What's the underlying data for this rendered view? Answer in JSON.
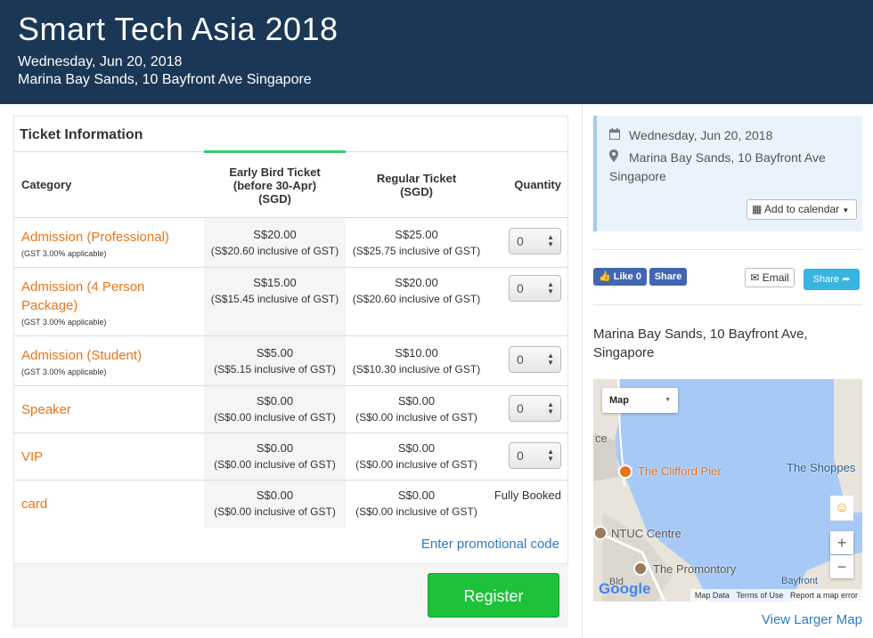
{
  "header": {
    "title": "Smart Tech Asia 2018",
    "date": "Wednesday, Jun 20, 2018",
    "venue": "Marina Bay Sands, 10 Bayfront Ave Singapore"
  },
  "tickets": {
    "section_title": "Ticket Information",
    "columns": {
      "category": "Category",
      "early_line1": "Early Bird Ticket",
      "early_line2": "(before 30-Apr)",
      "early_line3": "(SGD)",
      "regular_line1": "Regular Ticket",
      "regular_line2": "(SGD)",
      "quantity": "Quantity"
    },
    "rows": [
      {
        "name_line1": "Admission (Professional)",
        "name_line2": "",
        "gst": "(GST 3.00% applicable)",
        "early_price": "S$20.00",
        "early_incl": "(S$20.60 inclusive of GST)",
        "regular_price": "S$25.00",
        "regular_incl": "(S$25.75 inclusive of GST)",
        "qty": "0",
        "status": ""
      },
      {
        "name_line1": "Admission (4 Person",
        "name_line2": "Package)",
        "gst": "(GST 3.00% applicable)",
        "early_price": "S$15.00",
        "early_incl": "(S$15.45 inclusive of GST)",
        "regular_price": "S$20.00",
        "regular_incl": "(S$20.60 inclusive of GST)",
        "qty": "0",
        "status": ""
      },
      {
        "name_line1": "Admission (Student)",
        "name_line2": "",
        "gst": "(GST 3.00% applicable)",
        "early_price": "S$5.00",
        "early_incl": "(S$5.15 inclusive of GST)",
        "regular_price": "S$10.00",
        "regular_incl": "(S$10.30 inclusive of GST)",
        "qty": "0",
        "status": ""
      },
      {
        "name_line1": "Speaker",
        "name_line2": "",
        "gst": "",
        "early_price": "S$0.00",
        "early_incl": "(S$0.00 inclusive of GST)",
        "regular_price": "S$0.00",
        "regular_incl": "(S$0.00 inclusive of GST)",
        "qty": "0",
        "status": ""
      },
      {
        "name_line1": "VIP",
        "name_line2": "",
        "gst": "",
        "early_price": "S$0.00",
        "early_incl": "(S$0.00 inclusive of GST)",
        "regular_price": "S$0.00",
        "regular_incl": "(S$0.00 inclusive of GST)",
        "qty": "0",
        "status": ""
      },
      {
        "name_line1": "card",
        "name_line2": "",
        "gst": "",
        "early_price": "S$0.00",
        "early_incl": "(S$0.00 inclusive of GST)",
        "regular_price": "S$0.00",
        "regular_incl": "(S$0.00 inclusive of GST)",
        "qty": "",
        "status": "Fully Booked"
      }
    ],
    "promo_link": "Enter promotional code",
    "register_label": "Register"
  },
  "sidebar": {
    "date": "Wednesday, Jun 20, 2018",
    "venue_line1": "Marina Bay Sands, 10 Bayfront Ave",
    "venue_line2": "Singapore",
    "add_to_calendar": "Add to calendar",
    "fb_like": "Like 0",
    "fb_share": "Share",
    "email": "Email",
    "share": "Share",
    "address": "Marina Bay Sands, 10 Bayfront Ave, Singapore",
    "view_larger_map": "View Larger Map"
  },
  "map": {
    "type_select": "Map",
    "labels": {
      "clifford": "The Clifford Pier",
      "ntuc": "NTUC Centre",
      "promontory": "The Promontory",
      "shoppes": "The Shoppes",
      "bayfront": "Bayfront",
      "ce": "ce",
      "bld": "Bld"
    },
    "google": "Google",
    "footer": {
      "data": "Map Data",
      "terms": "Terms of Use",
      "report": "Report a map error"
    }
  },
  "icons": {
    "calendar": "calendar-icon",
    "marker": "map-marker-icon",
    "email": "envelope-icon",
    "share": "share-arrow-icon",
    "facebook": "facebook-icon",
    "pegman": "pegman-icon"
  },
  "colors": {
    "header_bg": "#1b3756",
    "category_text": "#e8751a",
    "register_button": "#1ec13a",
    "link": "#2c7bc4",
    "early_bird_accent": "#2ecc71"
  }
}
